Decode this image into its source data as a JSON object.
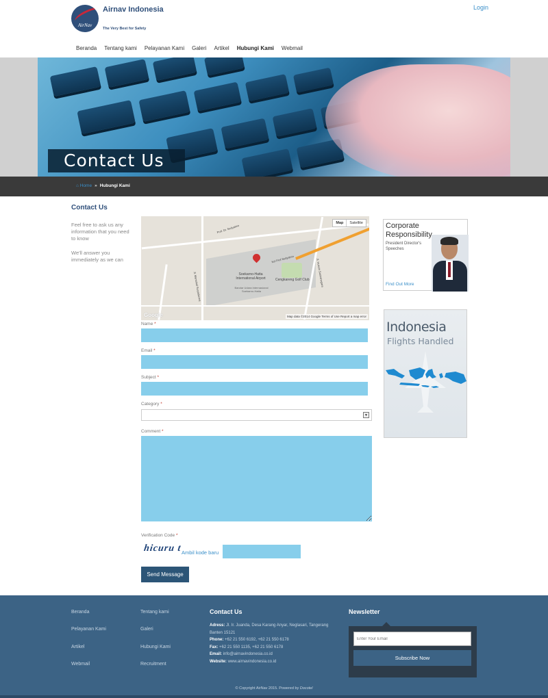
{
  "header": {
    "logo_name": "Airnav Indonesia",
    "logo_tagline": "The Very Best for Safety",
    "logo_mark_text": "AirNav",
    "login": "Login"
  },
  "nav": {
    "items": [
      {
        "label": "Beranda"
      },
      {
        "label": "Tentang kami"
      },
      {
        "label": "Pelayanan Kami"
      },
      {
        "label": "Galeri"
      },
      {
        "label": "Artikel"
      },
      {
        "label": "Hubungi Kami"
      },
      {
        "label": "Webmail"
      }
    ],
    "active": "Hubungi Kami"
  },
  "banner": {
    "title": "Contact Us"
  },
  "breadcrumb": {
    "home": "Home",
    "separator": "»",
    "current": "Hubungi Kami",
    "home_icon": "home-icon"
  },
  "sidebar_left": {
    "title": "Contact Us",
    "text1": "Feel free to ask us any information that you need to know",
    "text2": "We'll answer you immediately as we can"
  },
  "map": {
    "btn_map": "Map",
    "btn_satellite": "Satellite",
    "google": "Google",
    "footer": "Map data ©2014 Google    Terms of Use    Report a map error",
    "labels": {
      "airport": "Soekarno-Hatta International Airport",
      "terminal": "Bandar Udara Internasional Soekarno-Hatta",
      "golf": "Cengkareng Golf Club",
      "road1": "Prof. Dr. Sedyatmo",
      "road2": "Jl. Marsekal Suryadarma",
      "road3": "Jl. Husein Sastranegara",
      "toll": "Kol Prof Sedyatmo"
    }
  },
  "form": {
    "name_label": "Name",
    "email_label": "Email",
    "subject_label": "Subject",
    "category_label": "Category",
    "comment_label": "Comment",
    "verification_label": "Verification Code",
    "required_mark": "*",
    "name_value": "",
    "email_value": "",
    "subject_value": "",
    "category_value": "",
    "comment_value": "",
    "captcha_text": "hicuru t",
    "captcha_link": "Ambil kode baru",
    "captcha_value": "",
    "submit": "Send Message"
  },
  "sidebar_right": {
    "corp_title": "Corporate Responsibility",
    "corp_sub": "President Director's Speeches",
    "corp_link": "Find Out More",
    "indo_title": "Indonesia",
    "indo_sub": "Flights Handled"
  },
  "footer": {
    "links_col1": [
      "Beranda",
      "Pelayanan Kami",
      "Artikel",
      "Webmail"
    ],
    "links_col2": [
      "Tentang kami",
      "Galeri",
      "Hubungi Kami",
      "Recruitment"
    ],
    "contact_title": "Contact Us",
    "address_label": "Adress:",
    "address": "Jl. Ir. Juanda, Desa Karang Anyar, Neglasari, Tangerang Banten 15121",
    "phone_label": "Phone:",
    "phone": "+62 21 550 6192, +62 21 550 6178",
    "fax_label": "Fax:",
    "fax": "+62 21 550 1135, +62 21 550 6178",
    "email_label": "Email:",
    "email": "info@airnavindonesia.co.id",
    "website_label": "Website:",
    "website": "www.airnavindonesia.co.id",
    "newsletter_title": "Newsletter",
    "newsletter_placeholder": "Enter Your Email",
    "newsletter_button": "Subscribe Now",
    "copyright": "© Copyright AirNav 2015. Powered by",
    "powered_by": "Docotel"
  },
  "colors": {
    "brand_blue": "#2f4f7a",
    "link_blue": "#3a8fc9",
    "input_fill": "#87ceeb",
    "footer_bg": "#3c6385",
    "breadcrumb_bg": "#3a3a3a",
    "required_red": "#c0392b"
  }
}
